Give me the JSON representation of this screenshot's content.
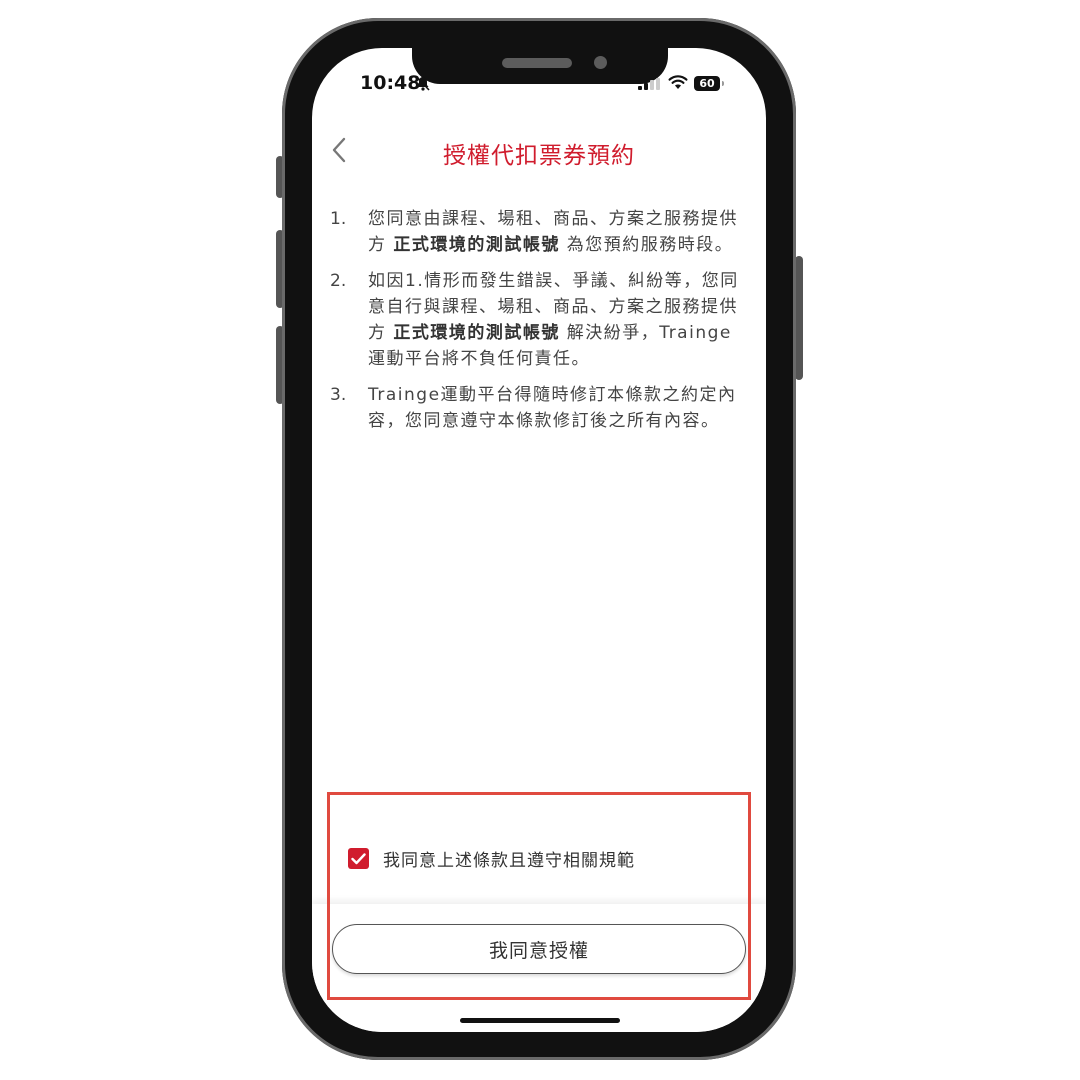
{
  "status_bar": {
    "time": "10:48",
    "battery": "60"
  },
  "header": {
    "title": "授權代扣票券預約"
  },
  "terms": [
    {
      "number": "1.",
      "before": "您同意由課程、場租、商品、方案之服務提供方 ",
      "bold": "正式環境的測試帳號",
      "after": " 為您預約服務時段。"
    },
    {
      "number": "2.",
      "before": "如因1.情形而發生錯誤、爭議、糾紛等，您同意自行與課程、場租、商品、方案之服務提供方 ",
      "bold": "正式環境的測試帳號",
      "after": " 解決紛爭，Trainge運動平台將不負任何責任。"
    },
    {
      "number": "3.",
      "before": "Trainge運動平台得隨時修訂本條款之約定內容，您同意遵守本條款修訂後之所有內容。",
      "bold": "",
      "after": ""
    }
  ],
  "agreement": {
    "checkbox_label": "我同意上述條款且遵守相關規範",
    "checked": true,
    "button_label": "我同意授權"
  },
  "colors": {
    "accent": "#d01c2d",
    "highlight": "#e04a3f"
  }
}
